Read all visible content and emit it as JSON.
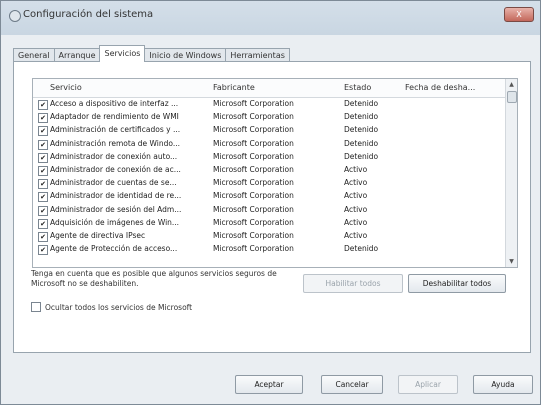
{
  "window": {
    "title": "Configuración del sistema",
    "close_glyph": "X"
  },
  "tabs": [
    {
      "label": "General",
      "active": false
    },
    {
      "label": "Arranque",
      "active": false
    },
    {
      "label": "Servicios",
      "active": true
    },
    {
      "label": "Inicio de Windows",
      "active": false
    },
    {
      "label": "Herramientas",
      "active": false
    }
  ],
  "services": {
    "columns": [
      "Servicio",
      "Fabricante",
      "Estado",
      "Fecha de desha..."
    ],
    "rows": [
      {
        "checked": true,
        "name": "Acceso a dispositivo de interfaz ...",
        "vendor": "Microsoft Corporation",
        "status": "Detenido",
        "date": ""
      },
      {
        "checked": true,
        "name": "Adaptador de rendimiento de WMI",
        "vendor": "Microsoft Corporation",
        "status": "Detenido",
        "date": ""
      },
      {
        "checked": true,
        "name": "Administración de certificados y ...",
        "vendor": "Microsoft Corporation",
        "status": "Detenido",
        "date": ""
      },
      {
        "checked": true,
        "name": "Administración remota de Windo...",
        "vendor": "Microsoft Corporation",
        "status": "Detenido",
        "date": ""
      },
      {
        "checked": true,
        "name": "Administrador de conexión auto...",
        "vendor": "Microsoft Corporation",
        "status": "Detenido",
        "date": ""
      },
      {
        "checked": true,
        "name": "Administrador de conexión de ac...",
        "vendor": "Microsoft Corporation",
        "status": "Activo",
        "date": ""
      },
      {
        "checked": true,
        "name": "Administrador de cuentas de se...",
        "vendor": "Microsoft Corporation",
        "status": "Activo",
        "date": ""
      },
      {
        "checked": true,
        "name": "Administrador de identidad de re...",
        "vendor": "Microsoft Corporation",
        "status": "Activo",
        "date": ""
      },
      {
        "checked": true,
        "name": "Administrador de sesión del Adm...",
        "vendor": "Microsoft Corporation",
        "status": "Activo",
        "date": ""
      },
      {
        "checked": true,
        "name": "Adquisición de imágenes de Win...",
        "vendor": "Microsoft Corporation",
        "status": "Activo",
        "date": ""
      },
      {
        "checked": true,
        "name": "Agente de directiva IPsec",
        "vendor": "Microsoft Corporation",
        "status": "Activo",
        "date": ""
      },
      {
        "checked": true,
        "name": "Agente de Protección de acceso...",
        "vendor": "Microsoft Corporation",
        "status": "Detenido",
        "date": ""
      }
    ]
  },
  "note": "Tenga en cuenta que es posible que algunos servicios seguros de Microsoft no se deshabiliten.",
  "buttons": {
    "enable_all": "Habilitar todos",
    "disable_all": "Deshabilitar todos",
    "accept": "Aceptar",
    "cancel": "Cancelar",
    "apply": "Aplicar",
    "help": "Ayuda"
  },
  "hide_ms_label": "Ocultar todos los servicios de Microsoft",
  "hide_ms_checked": false,
  "icons": {
    "title": "system-config-icon",
    "scroll_up": "chevron-up-icon",
    "scroll_down": "chevron-down-icon"
  }
}
